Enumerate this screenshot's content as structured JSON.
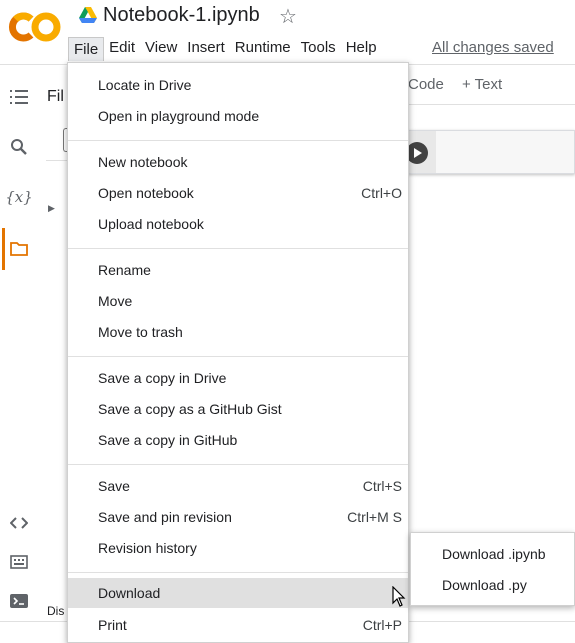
{
  "header": {
    "logo_text": "CO",
    "notebook_title": "Notebook-1.ipynb",
    "save_status": "All changes saved"
  },
  "menubar": {
    "items": [
      "File",
      "Edit",
      "View",
      "Insert",
      "Runtime",
      "Tools",
      "Help"
    ],
    "active": "File"
  },
  "sidebar": {
    "icons": [
      "table-of-contents-icon",
      "search-icon",
      "variables-icon",
      "folder-icon",
      "code-snippets-icon",
      "command-palette-icon",
      "terminal-icon"
    ],
    "variables_glyph": "{x}",
    "panel_title": "Fil",
    "disk_label": "Dis"
  },
  "toolbar": {
    "add_code": "Code",
    "add_text": "Text",
    "plus": "+"
  },
  "file_menu": {
    "groups": [
      [
        {
          "label": "Locate in Drive",
          "shortcut": ""
        },
        {
          "label": "Open in playground mode",
          "shortcut": ""
        }
      ],
      [
        {
          "label": "New notebook",
          "shortcut": ""
        },
        {
          "label": "Open notebook",
          "shortcut": "Ctrl+O"
        },
        {
          "label": "Upload notebook",
          "shortcut": ""
        }
      ],
      [
        {
          "label": "Rename",
          "shortcut": ""
        },
        {
          "label": "Move",
          "shortcut": ""
        },
        {
          "label": "Move to trash",
          "shortcut": ""
        }
      ],
      [
        {
          "label": "Save a copy in Drive",
          "shortcut": ""
        },
        {
          "label": "Save a copy as a GitHub Gist",
          "shortcut": ""
        },
        {
          "label": "Save a copy in GitHub",
          "shortcut": ""
        }
      ],
      [
        {
          "label": "Save",
          "shortcut": "Ctrl+S"
        },
        {
          "label": "Save and pin revision",
          "shortcut": "Ctrl+M S"
        },
        {
          "label": "Revision history",
          "shortcut": ""
        }
      ],
      [
        {
          "label": "Download",
          "shortcut": ""
        },
        {
          "label": "Print",
          "shortcut": "Ctrl+P"
        }
      ]
    ],
    "hovered": "Download"
  },
  "download_submenu": {
    "items": [
      "Download .ipynb",
      "Download .py"
    ]
  },
  "colors": {
    "accent_orange": "#e37400",
    "logo_orange": "#f9ab00",
    "menu_hover": "#e0e0e0"
  }
}
